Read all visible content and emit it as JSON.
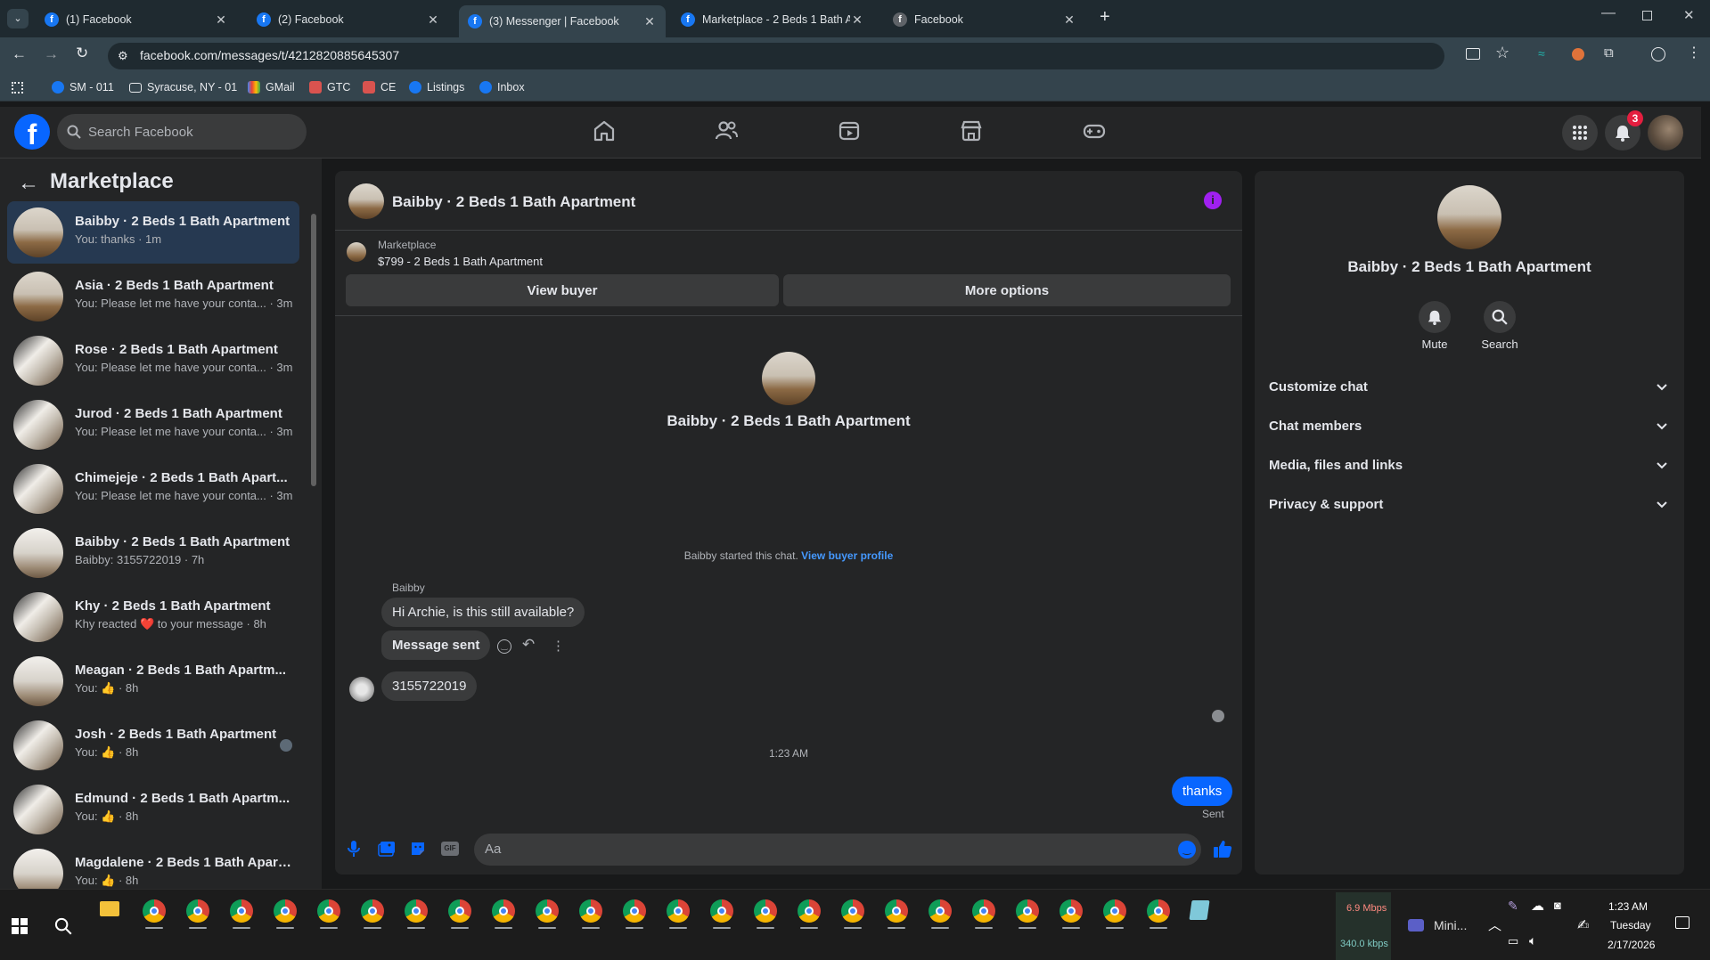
{
  "browser": {
    "tabs": [
      {
        "label": "(1) Facebook"
      },
      {
        "label": "(2) Facebook"
      },
      {
        "label": "(3) Messenger | Facebook"
      },
      {
        "label": "Marketplace - 2 Beds 1 Bath Ap"
      },
      {
        "label": "Facebook"
      }
    ],
    "url": "facebook.com/messages/t/4212820885645307",
    "bookmarks": [
      {
        "label": "SM - 011"
      },
      {
        "label": "Syracuse, NY - 01"
      },
      {
        "label": "GMail"
      },
      {
        "label": "GTC"
      },
      {
        "label": "CE"
      },
      {
        "label": "Listings"
      },
      {
        "label": "Inbox"
      }
    ]
  },
  "header": {
    "search_placeholder": "Search Facebook",
    "notification_count": "3"
  },
  "sidebar": {
    "title": "Marketplace",
    "conversations": [
      {
        "name": "Baibby · 2 Beds 1 Bath Apartment",
        "preview": "You: thanks · 1m"
      },
      {
        "name": "Asia · 2 Beds 1 Bath Apartment",
        "preview": "You: Please let me have your conta... · 3m"
      },
      {
        "name": "Rose · 2 Beds 1 Bath Apartment",
        "preview": "You: Please let me have your conta... · 3m"
      },
      {
        "name": "Jurod · 2 Beds 1 Bath Apartment",
        "preview": "You: Please let me have your conta... · 3m"
      },
      {
        "name": "Chimejeje · 2 Beds 1 Bath Apart...",
        "preview": "You: Please let me have your conta... · 3m"
      },
      {
        "name": "Baibby · 2 Beds 1 Bath Apartment",
        "preview": "Baibby: 3155722019 · 7h"
      },
      {
        "name": "Khy · 2 Beds 1 Bath Apartment",
        "preview": "Khy reacted ❤️ to your message · 8h"
      },
      {
        "name": "Meagan · 2 Beds 1 Bath Apartm...",
        "preview": "You: 👍 · 8h"
      },
      {
        "name": "Josh · 2 Beds 1 Bath Apartment",
        "preview": "You: 👍 · 8h"
      },
      {
        "name": "Edmund · 2 Beds 1 Bath Apartm...",
        "preview": "You: 👍 · 8h"
      },
      {
        "name": "Magdalene · 2 Beds 1 Bath Apart...",
        "preview": "You: 👍 · 8h"
      }
    ]
  },
  "chat": {
    "title": "Baibby · 2 Beds 1 Bath Apartment",
    "listing_source": "Marketplace",
    "listing_title": "$799 - 2 Beds 1 Bath Apartment",
    "view_buyer_label": "View buyer",
    "more_options_label": "More options",
    "intro_name": "Baibby · 2 Beds 1 Bath Apartment",
    "started_text": "Baibby started this chat.",
    "view_profile_link": "View buyer profile",
    "sender_name": "Baibby",
    "messages": [
      {
        "text": "Hi Archie, is this still available?"
      },
      {
        "text": "Message sent"
      },
      {
        "text": "3155722019"
      }
    ],
    "timestamp": "1:23 AM",
    "my_message": "thanks",
    "my_status": "Sent",
    "composer_placeholder": "Aa"
  },
  "details": {
    "name": "Baibby · 2 Beds 1 Bath Apartment",
    "mute_label": "Mute",
    "search_label": "Search",
    "sections": [
      {
        "label": "Customize chat"
      },
      {
        "label": "Chat members"
      },
      {
        "label": "Media, files and links"
      },
      {
        "label": "Privacy & support"
      }
    ]
  },
  "taskbar": {
    "net_down": "6.9 Mbps",
    "net_up": "340.0 kbps",
    "mini_app": "Mini...",
    "time": "1:23 AM",
    "day": "Tuesday",
    "date": "2/17/2026"
  },
  "colors": {
    "accent": "#0866ff",
    "bg": "#18191a",
    "surface": "#242526",
    "link": "#4599ff",
    "badge": "#e41e3f"
  }
}
